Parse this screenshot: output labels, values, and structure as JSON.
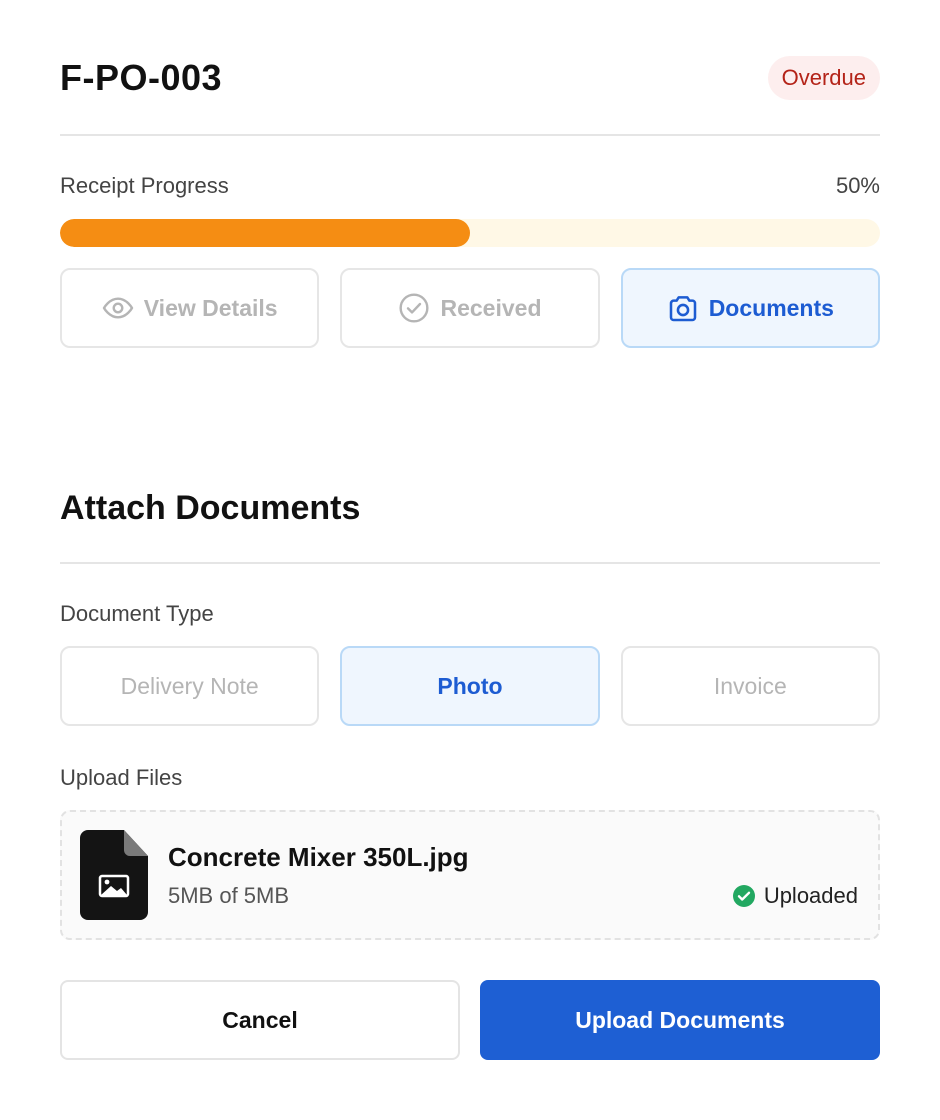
{
  "header": {
    "po_id": "F-PO-003",
    "status": "Overdue"
  },
  "progress": {
    "label": "Receipt Progress",
    "value_text": "50%",
    "fraction": 0.5,
    "fill_color": "#f58d13",
    "track_color": "#fff8e6"
  },
  "tabs": [
    {
      "label": "View Details",
      "icon": "eye-icon",
      "active": false
    },
    {
      "label": "Received",
      "icon": "check-circle-icon",
      "active": false
    },
    {
      "label": "Documents",
      "icon": "camera-icon",
      "active": true
    }
  ],
  "attach": {
    "title": "Attach Documents",
    "doc_type_label": "Document Type",
    "doc_types": [
      {
        "label": "Delivery Note",
        "active": false
      },
      {
        "label": "Photo",
        "active": true
      },
      {
        "label": "Invoice",
        "active": false
      }
    ],
    "upload_label": "Upload Files",
    "file": {
      "name": "Concrete Mixer 350L.jpg",
      "size": "5MB of 5MB",
      "status": "Uploaded",
      "icon": "image-file-icon"
    }
  },
  "actions": {
    "cancel": "Cancel",
    "upload": "Upload Documents"
  },
  "colors": {
    "accent": "#1e5fd3",
    "overdue_text": "#b42318",
    "overdue_bg": "#fdeeee",
    "success": "#22a861"
  }
}
